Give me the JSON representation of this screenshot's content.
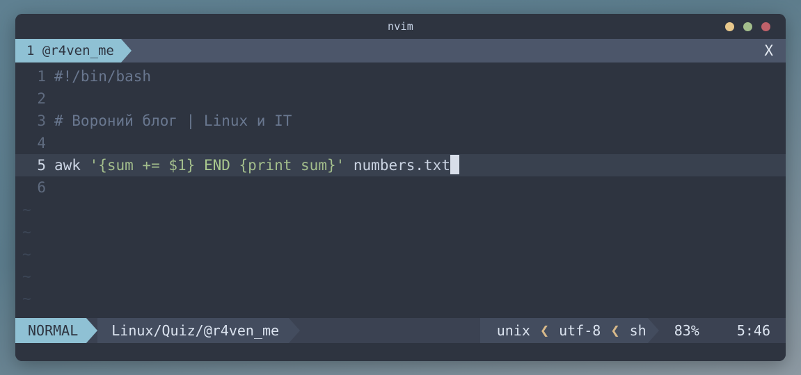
{
  "window": {
    "title": "nvim",
    "controls": [
      {
        "name": "minimize-button",
        "color": "#e8c88c"
      },
      {
        "name": "maximize-button",
        "color": "#a3be8c"
      },
      {
        "name": "close-button",
        "color": "#bf616a"
      }
    ]
  },
  "tabline": {
    "tab": {
      "number": "1",
      "label": "@r4ven_me",
      "text": "1 @r4ven_me"
    },
    "close_label": "X"
  },
  "editor": {
    "lines": [
      {
        "num": "1",
        "text": "#!/bin/bash",
        "current": false
      },
      {
        "num": "2",
        "text": "",
        "current": false
      },
      {
        "num": "3",
        "text": "# Вороний блог | Linux и IT",
        "current": false
      },
      {
        "num": "4",
        "text": "",
        "current": false
      },
      {
        "num": "5",
        "text": "awk '{sum += $1} END {print sum}' numbers.txt",
        "current": true
      },
      {
        "num": "6",
        "text": "",
        "current": false
      }
    ],
    "current_line": {
      "num": "5",
      "tokens": [
        {
          "text": "awk ",
          "kind": "plain"
        },
        {
          "text": "'{sum += $1} ",
          "kind": "str"
        },
        {
          "text": "END ",
          "kind": "kw"
        },
        {
          "text": "{print sum}'",
          "kind": "str"
        },
        {
          "text": " numbers.txt",
          "kind": "file"
        }
      ]
    },
    "tilde": "~",
    "tilde_count": 5
  },
  "statusline": {
    "mode": "NORMAL",
    "file": "Linux/Quiz/@r4ven_me",
    "fileformat": "unix",
    "encoding": "utf-8",
    "filetype": "sh",
    "percent": "83%",
    "position": "5:46",
    "separator": "❮"
  }
}
